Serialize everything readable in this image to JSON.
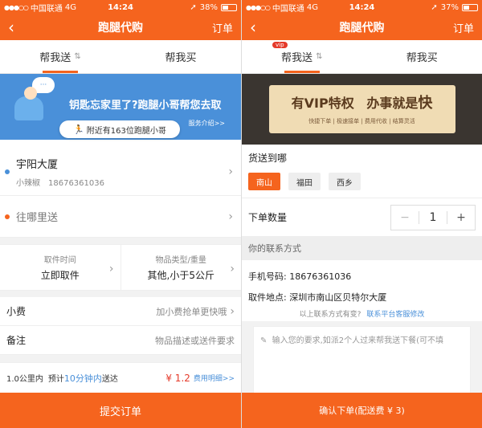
{
  "status_left": {
    "carrier": "中国联通",
    "network": "4G",
    "time": "14:24",
    "battery": "38%",
    "battery_level": 0.38
  },
  "status_right": {
    "carrier": "中国联通",
    "network": "4G",
    "time": "14:24",
    "battery": "37%",
    "battery_level": 0.37
  },
  "nav": {
    "title": "跑腿代购",
    "order_label": "订单"
  },
  "tabs": {
    "send": "帮我送",
    "buy": "帮我买",
    "vip": "vip"
  },
  "left": {
    "banner": {
      "title": "钥匙忘家里了?跑腿小哥帮您去取",
      "service_link": "服务介绍>>"
    },
    "nearby": "附近有163位跑腿小哥",
    "from": {
      "name": "宇阳大厦",
      "contact": "小辣椒",
      "phone": "18676361036"
    },
    "to_placeholder": "往哪里送",
    "pickup_time": {
      "label": "取件时间",
      "value": "立即取件"
    },
    "item_type": {
      "label": "物品类型/重量",
      "value": "其他,小于5公斤"
    },
    "tip": {
      "label": "小费",
      "value": "加小费抢单更快哦"
    },
    "remark": {
      "label": "备注",
      "value": "物品描述或送件要求"
    },
    "estimate": {
      "distance": "1.0公里内",
      "prefix": "预计",
      "eta": "10分钟内",
      "suffix": "送达",
      "price": "¥ 1.2",
      "detail": "费用明细>>"
    },
    "submit": "提交订单"
  },
  "right": {
    "vip": {
      "title_a": "有VIP特权",
      "title_b": "办事就是",
      "title_c": "快",
      "sub": "快捷下单 | 极速接单 | 费用代收 | 结算灵活"
    },
    "deliver_label": "货送到哪",
    "districts": [
      "南山",
      "福田",
      "西乡"
    ],
    "qty_label": "下单数量",
    "qty_value": "1",
    "contact_head": "你的联系方式",
    "phone_label": "手机号码:",
    "phone_value": "18676361036",
    "pickup_label": "取件地点:",
    "pickup_value": "深圳市南山区贝特尔大厦",
    "changed_text": "以上联系方式有变?",
    "changed_link": "联系平台客服修改",
    "remark_placeholder": "输入您的要求,如派2个人过来帮我送下餐(可不填",
    "confirm": "确认下单(配送费 ¥ 3)"
  }
}
